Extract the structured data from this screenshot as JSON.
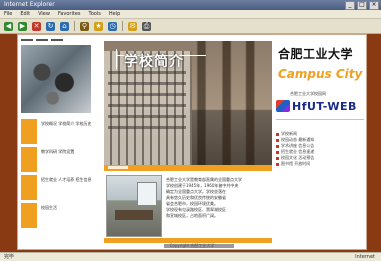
{
  "window": {
    "title": "Internet Explorer",
    "controls": [
      "_",
      "□",
      "×"
    ]
  },
  "menu": {
    "items": [
      "File",
      "Edit",
      "View",
      "Favorites",
      "Tools",
      "Help"
    ]
  },
  "toolbar": {
    "buttons": [
      {
        "name": "back-icon",
        "glyph": "◀",
        "color": "#2f8a2f"
      },
      {
        "name": "forward-icon",
        "glyph": "▶",
        "color": "#2f8a2f"
      },
      {
        "name": "stop-icon",
        "glyph": "✕",
        "color": "#c0392b"
      },
      {
        "name": "refresh-icon",
        "glyph": "↻",
        "color": "#2b6cb0"
      },
      {
        "name": "home-icon",
        "glyph": "⌂",
        "color": "#2b6cb0"
      },
      {
        "name": "search-icon",
        "glyph": "⚲",
        "color": "#7a5c12"
      },
      {
        "name": "favorites-icon",
        "glyph": "★",
        "color": "#d4a017"
      },
      {
        "name": "history-icon",
        "glyph": "◷",
        "color": "#2b6cb0"
      },
      {
        "name": "mail-icon",
        "glyph": "✉",
        "color": "#d4a017"
      },
      {
        "name": "print-icon",
        "glyph": "⎙",
        "color": "#555555"
      }
    ]
  },
  "site": {
    "hero_title": "学校简介",
    "brand_cjk": "合肥工业大学",
    "brand_campus": "Campus City",
    "brand_small": "合肥工业大学校园网",
    "brand_web": "HfUT-WEB",
    "nav": [
      {
        "label": "学校概况 学校简介 学校历史"
      },
      {
        "label": "教学科研 学院设置"
      },
      {
        "label": "招生就业 人才培养 招生信息"
      },
      {
        "label": "校园生活"
      }
    ],
    "news_lines": [
      "合肥工业大学是教育部直属的全国重点大学",
      "学校创建于1945年，1960年被中共中央",
      "确定为全国重点大学。学校坐落在",
      "具有悠久历史和优良传统的安徽省",
      "省会合肥市，校园环境优美。",
      "学校现有屯溪路校区、翡翠湖校区",
      "和宣城校区，占地面积广阔。"
    ],
    "right_news": [
      "学校新闻",
      "校园动态 最新通知",
      "学术讲座 信息公告",
      "招生就业 信息速递",
      "校园文化 活动预告",
      "图书馆 开放时间"
    ],
    "footer": "Copyright 合肥工业大学"
  },
  "status": {
    "left": "完毕",
    "right": "Internet"
  }
}
